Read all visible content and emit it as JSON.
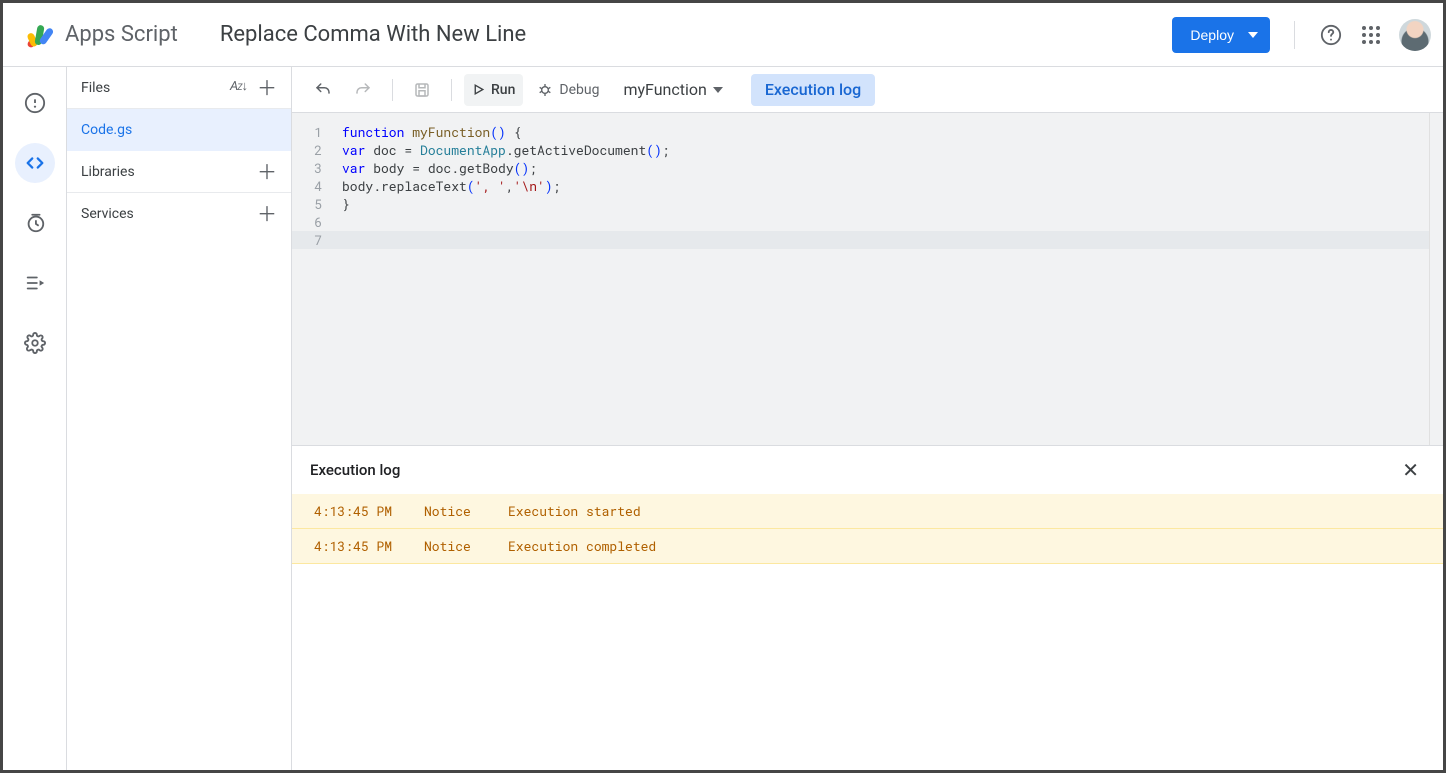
{
  "header": {
    "product": "Apps Script",
    "project_title": "Replace Comma With New Line",
    "deploy_label": "Deploy"
  },
  "panel": {
    "files_label": "Files",
    "file_name": "Code.gs",
    "libraries_label": "Libraries",
    "services_label": "Services"
  },
  "toolbar": {
    "run_label": "Run",
    "debug_label": "Debug",
    "function_name": "myFunction",
    "exec_log_label": "Execution log"
  },
  "code": {
    "lines": [
      1,
      2,
      3,
      4,
      5,
      6,
      7
    ],
    "l1_kw": "function",
    "l1_fn": " myFunction",
    "l1_paren": "()",
    "l1_brace": " {",
    "l2_kw": "var",
    "l2_a": " doc = ",
    "l2_cls": "DocumentApp",
    "l2_b": ".getActiveDocument",
    "l2_paren": "()",
    "l2_c": ";",
    "l3_kw": "var",
    "l3_a": " body = doc.getBody",
    "l3_paren": "()",
    "l3_b": ";",
    "l4_a": "body.replaceText",
    "l4_p1": "(",
    "l4_s1": "', '",
    "l4_c": ",",
    "l4_s2": "'\\n'",
    "l4_p2": ")",
    "l4_b": ";",
    "l5": "}"
  },
  "exec": {
    "title": "Execution log",
    "rows": [
      {
        "time": "4:13:45 PM",
        "level": "Notice",
        "msg": "Execution started"
      },
      {
        "time": "4:13:45 PM",
        "level": "Notice",
        "msg": "Execution completed"
      }
    ]
  }
}
